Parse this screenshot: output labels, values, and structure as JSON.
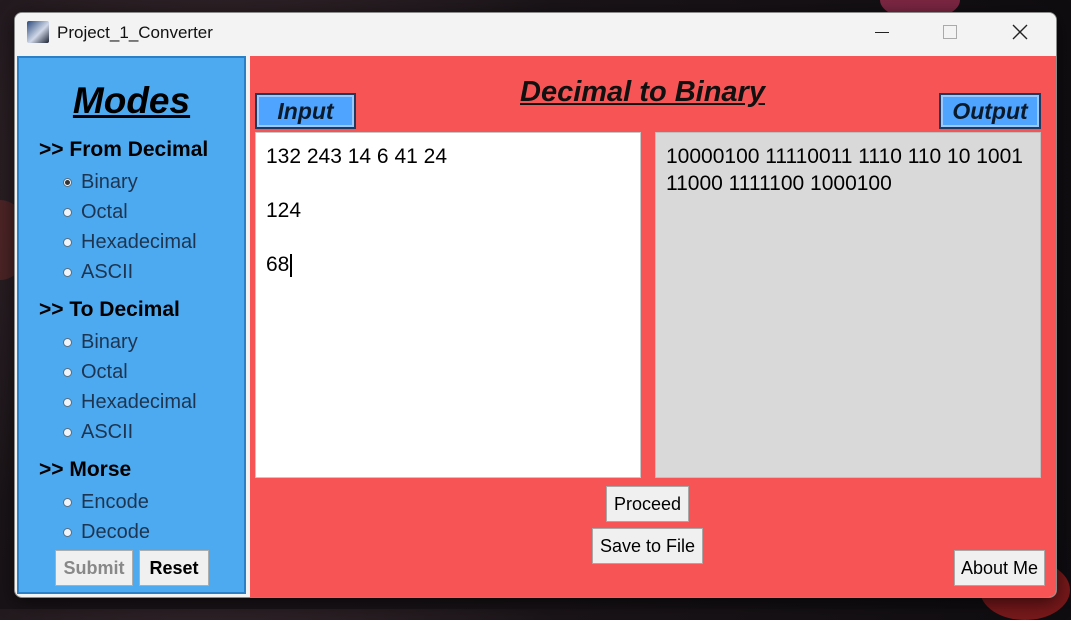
{
  "window": {
    "title": "Project_1_Converter"
  },
  "sidebar": {
    "title": "Modes",
    "sections": [
      {
        "heading": ">> From Decimal",
        "options": [
          "Binary",
          "Octal",
          "Hexadecimal",
          "ASCII"
        ]
      },
      {
        "heading": ">> To Decimal",
        "options": [
          "Binary",
          "Octal",
          "Hexadecimal",
          "ASCII"
        ]
      },
      {
        "heading": ">> Morse",
        "options": [
          "Encode",
          "Decode"
        ]
      }
    ],
    "selected": "From Decimal / Binary",
    "submit_label": "Submit",
    "reset_label": "Reset"
  },
  "main": {
    "title": "Decimal to Binary",
    "input_label": "Input",
    "output_label": "Output",
    "input_lines": [
      "132 243 14 6 41 24",
      "",
      "124",
      "",
      "68"
    ],
    "output_text": "10000100 11110011 1110 110 10 1001 11000 1111100 1000100",
    "proceed_label": "Proceed",
    "save_label": "Save to File",
    "about_label": "About Me"
  },
  "colors": {
    "sidebar_bg": "#4eaaf0",
    "main_bg": "#f75555",
    "label_bg": "#4ea4ff",
    "output_bg": "#d9d9d9"
  },
  "icons": {
    "app": "app-icon",
    "minimize": "minimize-icon",
    "maximize": "maximize-icon",
    "close": "close-icon"
  }
}
